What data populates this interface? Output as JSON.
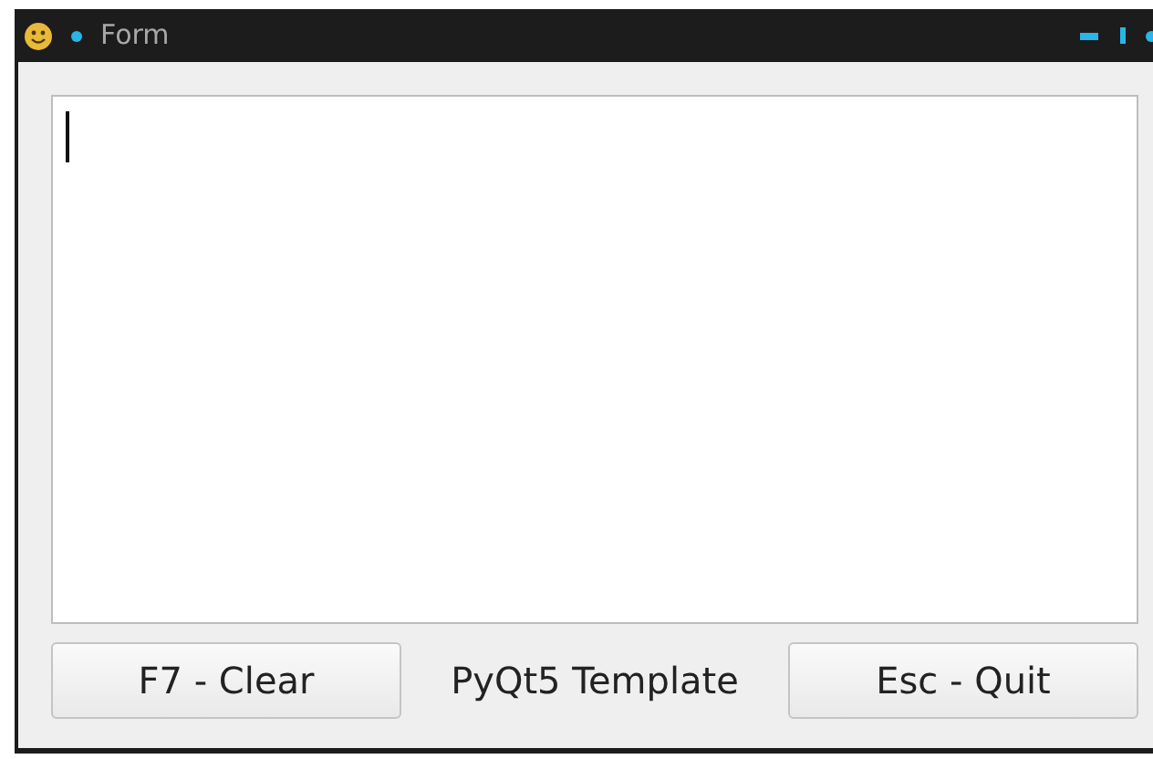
{
  "window": {
    "title": "Form"
  },
  "editor": {
    "focused": true
  },
  "footer": {
    "buttons": [
      {
        "label": "F7 - Clear"
      },
      {
        "label": "Esc - Quit"
      }
    ],
    "caption": "PyQt5 Template"
  }
}
